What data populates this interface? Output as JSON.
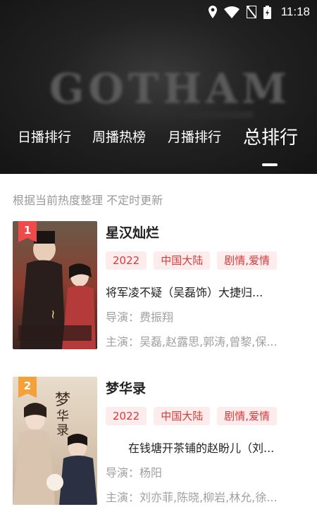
{
  "status_bar": {
    "time": "11:18",
    "icons": [
      "location-icon",
      "wifi-icon",
      "no-sim-icon",
      "battery-charging-icon"
    ]
  },
  "hero": {
    "background_text": "GOTHAM"
  },
  "tabs": [
    {
      "label": "日播排行",
      "active": false
    },
    {
      "label": "周播热榜",
      "active": false
    },
    {
      "label": "月播排行",
      "active": false
    },
    {
      "label": "总排行",
      "active": true
    }
  ],
  "subtitle": "根据当前热度整理 不定时更新",
  "items": [
    {
      "rank": "1",
      "rank_color": "#f04a4a",
      "title": "星汉灿烂",
      "tags": [
        "2022",
        "中国大陆",
        "剧情,爱情"
      ],
      "description": "将军凌不疑（吴磊饰）大捷归...",
      "director": "导演：费振翔",
      "cast": "主演：吴磊,赵露思,郭涛,曾黎,保..."
    },
    {
      "rank": "2",
      "rank_color": "#f5a13a",
      "title": "梦华录",
      "tags": [
        "2022",
        "中国大陆",
        "剧情,爱情"
      ],
      "description": "　　在钱塘开茶铺的赵盼儿（刘...",
      "director": "导演：杨阳",
      "cast": "主演：刘亦菲,陈晓,柳岩,林允,徐..."
    }
  ],
  "colors": {
    "tag_bg": "#fdecec",
    "tag_text": "#d93a3a",
    "hero_bg": "#1a1a1a"
  }
}
